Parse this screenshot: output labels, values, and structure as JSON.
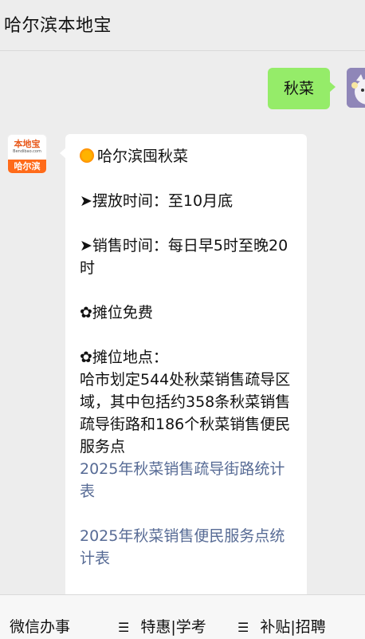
{
  "header": {
    "title": "哈尔滨本地宝"
  },
  "outgoing": {
    "text": "秋菜"
  },
  "bot": {
    "avatar": {
      "brand": "本地宝",
      "domain": "Bendibao.com",
      "city": "哈尔滨"
    }
  },
  "message": {
    "title": "哈尔滨囤秋菜",
    "display_time": "➤摆放时间：至10月底",
    "sale_time": "➤销售时间：每日早5时至晚20时",
    "free_booth": "✿摊位免费",
    "location_label": "✿摊位地点：",
    "location_detail": "哈市划定544处秋菜销售疏导区域，其中包括约358条秋菜销售疏导街路和186个秋菜销售便民服务点",
    "link1": "2025年秋菜销售疏导街路统计表",
    "link2": "2025年秋菜销售便民服务点统计表"
  },
  "menu": {
    "item1": "微信办事",
    "item2": "特惠|学考",
    "item3": "补贴|招聘",
    "icon": "☰"
  }
}
